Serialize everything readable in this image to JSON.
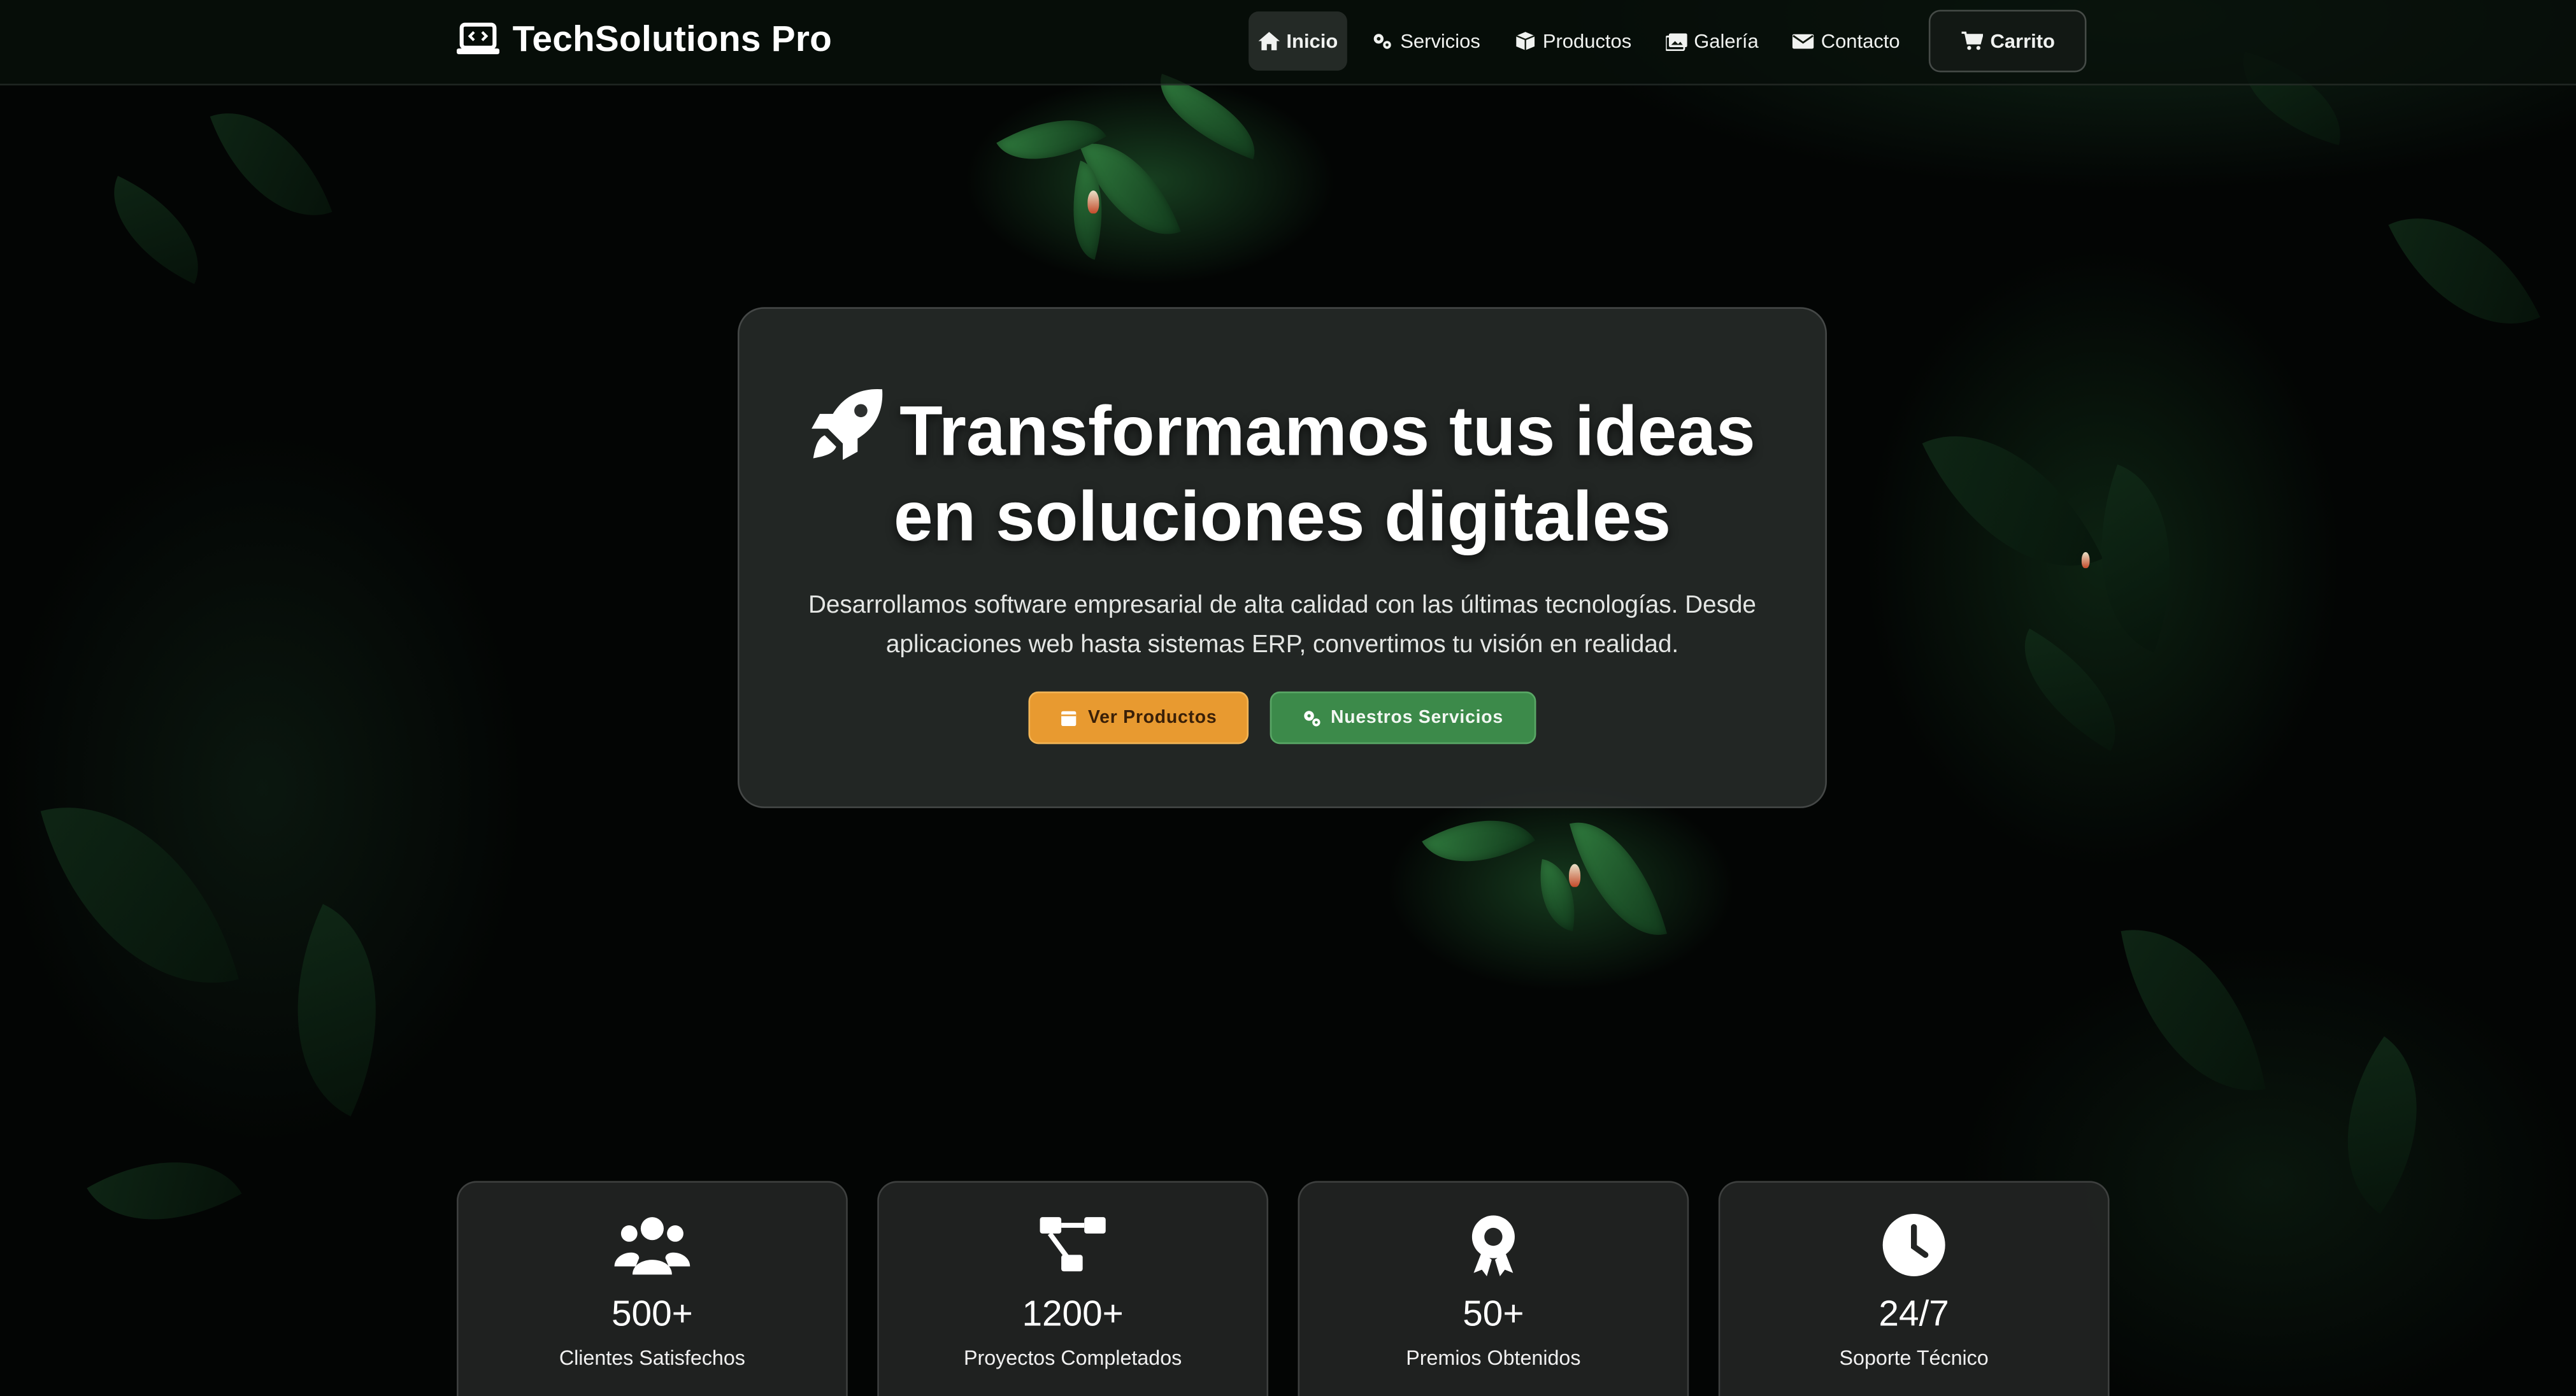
{
  "brand": {
    "name": "TechSolutions Pro",
    "icon": "laptop-code-icon"
  },
  "nav": [
    {
      "label": "Inicio",
      "icon": "home-icon",
      "active": true
    },
    {
      "label": "Servicios",
      "icon": "gears-icon"
    },
    {
      "label": "Productos",
      "icon": "box-icon"
    },
    {
      "label": "Galería",
      "icon": "images-icon"
    },
    {
      "label": "Contacto",
      "icon": "envelope-icon"
    },
    {
      "label": "Carrito",
      "icon": "cart-icon"
    }
  ],
  "hero": {
    "icon": "rocket-icon",
    "title_line1": "Transformamos tus ideas",
    "title_line2": "en soluciones digitales",
    "subtitle": "Desarrollamos software empresarial de alta calidad con las últimas tecnologías. Desde aplicaciones web hasta sistemas ERP, convertimos tu visión en realidad.",
    "buttons": [
      {
        "label": "Ver Productos",
        "icon": "box-icon",
        "color": "#e89a30"
      },
      {
        "label": "Nuestros Servicios",
        "icon": "gears-icon",
        "color": "#3c8a4a"
      }
    ]
  },
  "stats": [
    {
      "icon": "users-icon",
      "value": "500+",
      "label": "Clientes Satisfechos"
    },
    {
      "icon": "diagram-project-icon",
      "value": "1200+",
      "label": "Proyectos Completados"
    },
    {
      "icon": "award-icon",
      "value": "50+",
      "label": "Premios Obtenidos"
    },
    {
      "icon": "clock-icon",
      "value": "24/7",
      "label": "Soporte Técnico"
    }
  ],
  "colors": {
    "accent_orange": "#e89a30",
    "accent_green": "#3c8a4a",
    "background": "#030504"
  }
}
